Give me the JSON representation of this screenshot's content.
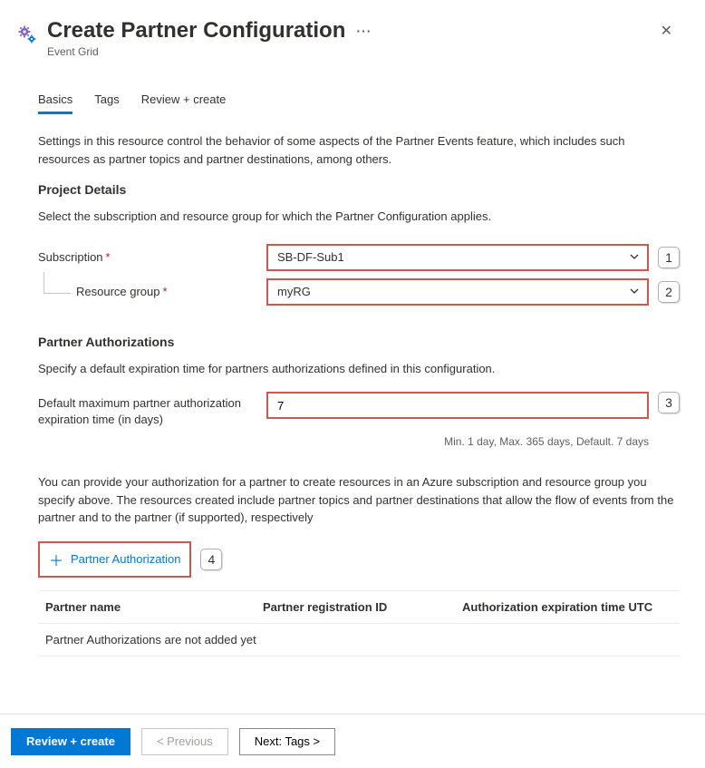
{
  "header": {
    "title": "Create Partner Configuration",
    "more": "···",
    "subtitle": "Event Grid"
  },
  "tabs": {
    "basics": "Basics",
    "tags": "Tags",
    "review": "Review + create"
  },
  "intro": "Settings in this resource control the behavior of some aspects of the Partner Events feature, which includes such resources as partner topics and partner destinations, among others.",
  "project": {
    "heading": "Project Details",
    "desc": "Select the subscription and resource group for which the Partner Configuration applies.",
    "subscription_label": "Subscription",
    "subscription_value": "SB-DF-Sub1",
    "rg_label": "Resource group",
    "rg_value": "myRG"
  },
  "auth": {
    "heading": "Partner Authorizations",
    "desc": "Specify a default expiration time for partners authorizations defined in this configuration.",
    "exp_label": "Default maximum partner authorization expiration time (in days)",
    "exp_value": "7",
    "exp_hint": "Min. 1 day, Max. 365 days, Default. 7 days",
    "para": "You can provide your authorization for a partner to create resources in an Azure subscription and resource group you specify above. The resources created include partner topics and partner destinations that allow the flow of events from the partner and to the partner (if supported), respectively",
    "add_label": "Partner Authorization",
    "col1": "Partner name",
    "col2": "Partner registration ID",
    "col3": "Authorization expiration time UTC",
    "empty": "Partner Authorizations are not added yet"
  },
  "callouts": {
    "c1": "1",
    "c2": "2",
    "c3": "3",
    "c4": "4"
  },
  "footer": {
    "review": "Review + create",
    "prev": "< Previous",
    "next": "Next: Tags >"
  }
}
